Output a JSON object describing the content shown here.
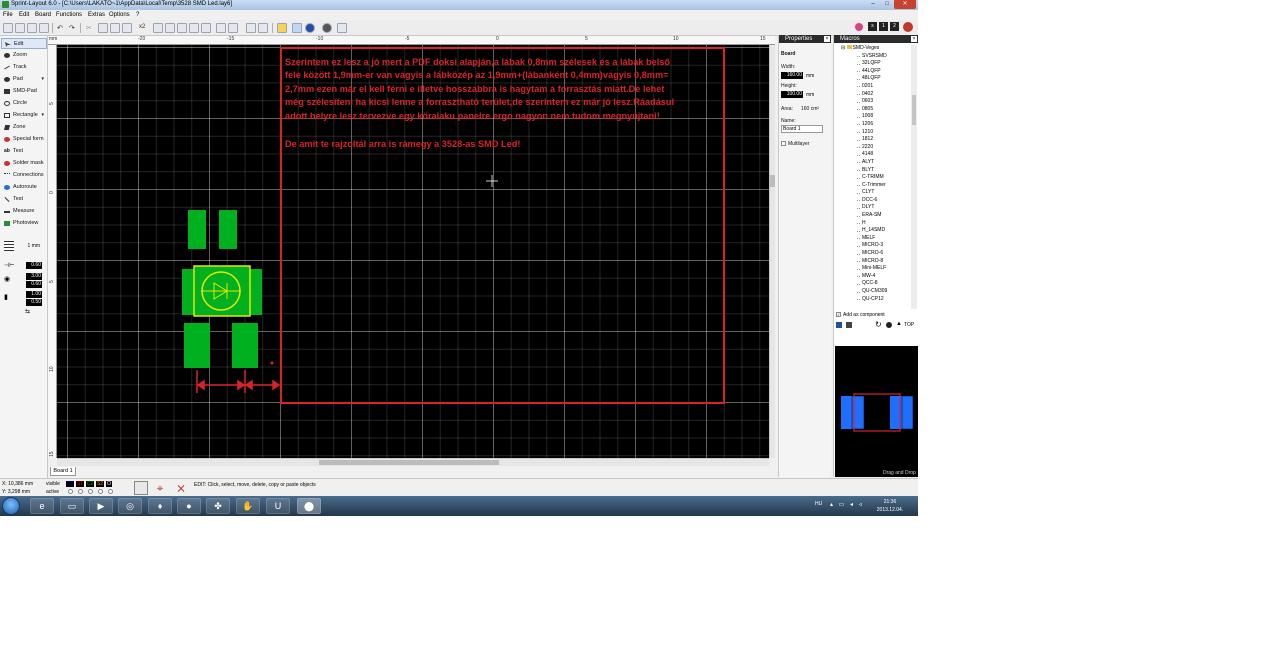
{
  "window": {
    "title": "Sprint-Layout 6.0 - [C:\\Users\\LAKATO~1\\AppData\\Local\\Temp\\3528 SMD Led.lay6]",
    "min_label": "–",
    "max_label": "□",
    "close_label": "✕"
  },
  "menu": {
    "items": [
      "File",
      "Edit",
      "Board",
      "Functions",
      "Extras",
      "Options",
      "?"
    ]
  },
  "toolbar": {
    "zoom_label": "x2"
  },
  "toolbar_right": {
    "badges": [
      "s",
      "1",
      "2"
    ]
  },
  "tools": {
    "items": [
      "Edit",
      "Zoom",
      "Track",
      "Pad",
      "SMD-Pad",
      "Circle",
      "Rectangle",
      "Zone",
      "Special form",
      "Text",
      "Solder mask",
      "Connections",
      "Autoroute",
      "Test",
      "Measure",
      "Photoview"
    ],
    "grid_label": "1 mm",
    "values": [
      "0.60",
      "3.00",
      "0.60",
      "1.00",
      "0.50"
    ]
  },
  "ruler": {
    "unit": "mm",
    "top_ticks": [
      "-20",
      "-15",
      "-10",
      "-5",
      "0",
      "5",
      "10",
      "15"
    ],
    "left_ticks": [
      "5",
      "0",
      "5",
      "10",
      "15"
    ]
  },
  "canvas": {
    "comment_lines": [
      "Szerintem ez lesz a jó mert a PDF doksi alapján,a lábak 0,8mm szélesek és  a lábak belső",
      "fele között 1,9mm-er van vagyis a lábközép az 1,9mm+(lábanként 0,4mm)vagyis 0,8mm=",
      "2,7mm ezen már el kell férni e illetve hosszabbra is hagytam a forrasztás miatt.De lehet",
      "még szélesíteni ha kicsi lenne a forrasztható terület,de szerintem ez már jó lesz.Ráadásul",
      "adott helyre lesz tervezve egy köralaku panelre ergo nagyon nem tudom megnyújtani!"
    ],
    "comment_line2": "De amit te rajzoltál arra is rámegy a  3528-as SMD Led!"
  },
  "tabs": {
    "board": "Board 1"
  },
  "properties": {
    "title": "Properties",
    "section": "Board",
    "width_label": "Width:",
    "width_value": "160.00",
    "height_label": "Height:",
    "height_value": "100.00",
    "unit": "mm",
    "area_label": "Area:",
    "area_value": "160 cm²",
    "name_label": "Name:",
    "name_value": "Board 1",
    "multilayer_label": "Multilayer"
  },
  "macros": {
    "title": "Macros",
    "root": "SMD-Veges",
    "items": [
      "SVSRSMD",
      "32LQFP",
      "44LQFP",
      "48LQFP",
      "0201",
      "0402",
      "0603",
      "0805",
      "1008",
      "1206",
      "1210",
      "1812",
      "2220",
      "4148",
      "ALYT",
      "BLYT",
      "C-TRIMM",
      "C-Trimmer",
      "CLYT",
      "DCC-6",
      "DLYT",
      "ERA-SM",
      "H",
      "H_14SMD",
      "MELF",
      "MICRO-3",
      "MICRO-6",
      "MICRO-8",
      "Mini-MELF",
      "MW-4",
      "QCC-8",
      "QU-CM309",
      "QU-CP12"
    ],
    "add_as_component": "Add as component",
    "top_label": "TOP",
    "drag_drop": "Drag and Drop"
  },
  "status": {
    "x_label": "X:",
    "x_value": "10,386 mm",
    "y_label": "Y:",
    "y_value": "3,298 mm",
    "visible_label": "visible",
    "active_label": "active",
    "layers": [
      "C1",
      "S1",
      "C2",
      "S2",
      "O"
    ],
    "layer_colors": [
      "#0000ff",
      "#ff0000",
      "#00aa00",
      "#ff8800",
      "#000000"
    ],
    "help_text": "EDIT:  Click, select, move, delete, copy or paste objects"
  },
  "taskbar": {
    "lang": "HU",
    "time": "21:36",
    "date": "2013.12.04."
  },
  "colors": {
    "canvas_bg": "#000000",
    "pad_green": "#00b01e",
    "annotation_red": "#d8232a",
    "silk_yellow": "#e8e800",
    "preview_pad": "#1f6fff"
  }
}
